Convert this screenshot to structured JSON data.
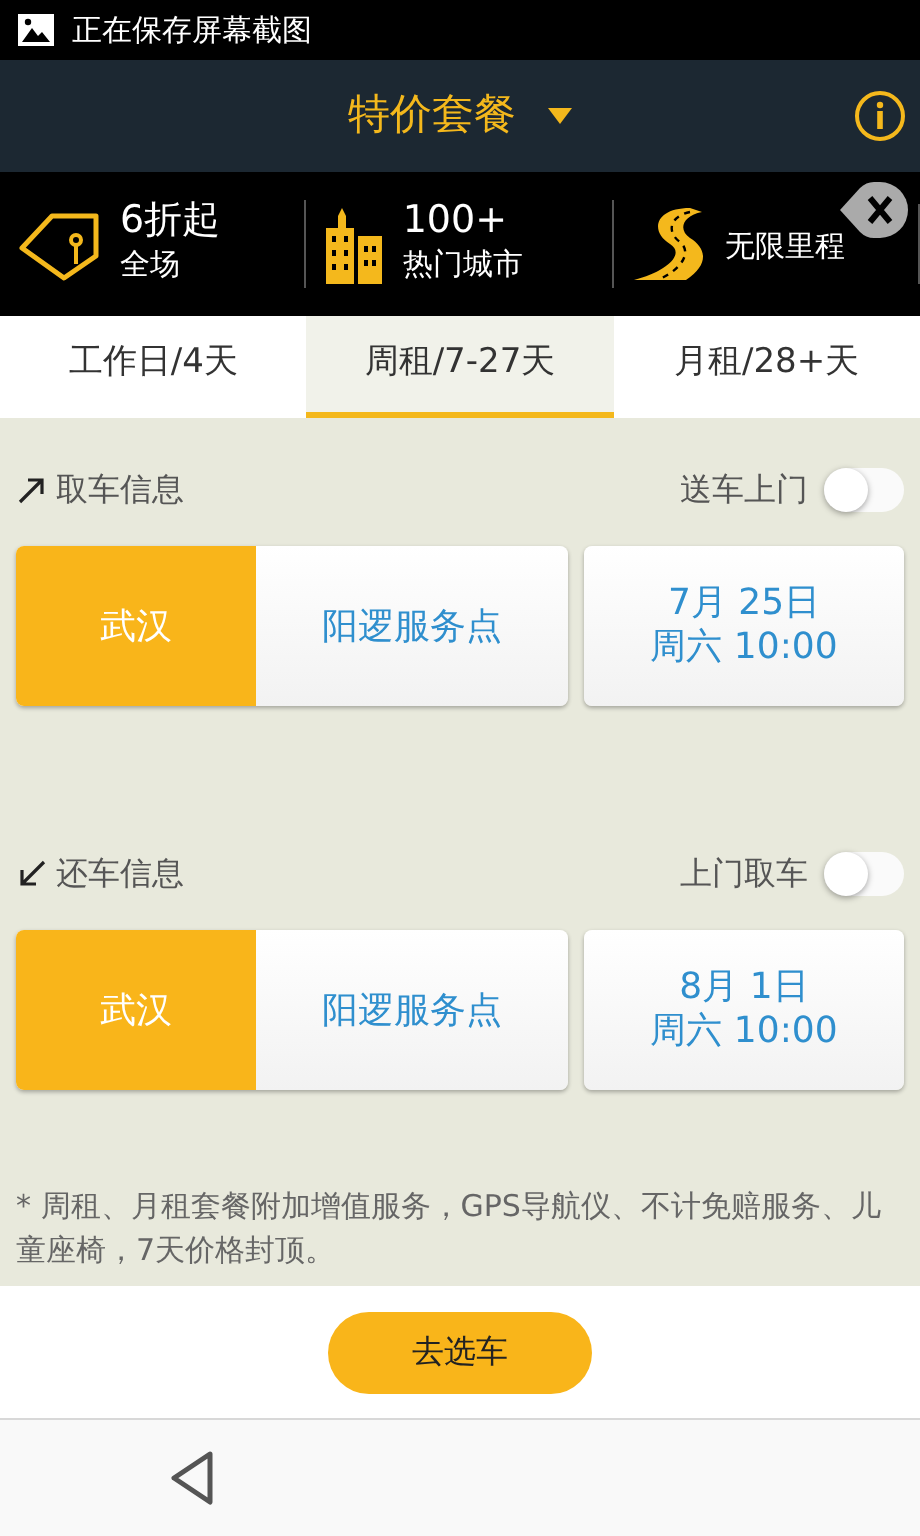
{
  "status_bar": {
    "notification": "正在保存屏幕截图"
  },
  "header": {
    "title": "特价套餐"
  },
  "promos": [
    {
      "kind": "tag",
      "title": "6折起",
      "subtitle": "全场"
    },
    {
      "kind": "city",
      "title": "100+",
      "subtitle": "热门城市"
    },
    {
      "kind": "road",
      "subtitle": "无限里程"
    }
  ],
  "tabs": [
    {
      "label": "工作日/4天",
      "selected": false
    },
    {
      "label": "周租/7-27天",
      "selected": true
    },
    {
      "label": "月租/28+天",
      "selected": false
    }
  ],
  "sections": [
    {
      "kind": "pickup",
      "title": "取车信息",
      "toggle_label": "送车上门",
      "toggle_on": false,
      "city": "武汉",
      "store": "阳逻服务点",
      "date": "7月  25日",
      "time": "周六 10:00"
    },
    {
      "kind": "return",
      "title": "还车信息",
      "toggle_label": "上门取车",
      "toggle_on": false,
      "city": "武汉",
      "store": "阳逻服务点",
      "date": "8月  1日",
      "time": "周六 10:00"
    }
  ],
  "note": "* 周租、月租套餐附加增值服务，GPS导航仪、不计免赔服务、儿童座椅，7天价格封顶。",
  "button": "去选车"
}
